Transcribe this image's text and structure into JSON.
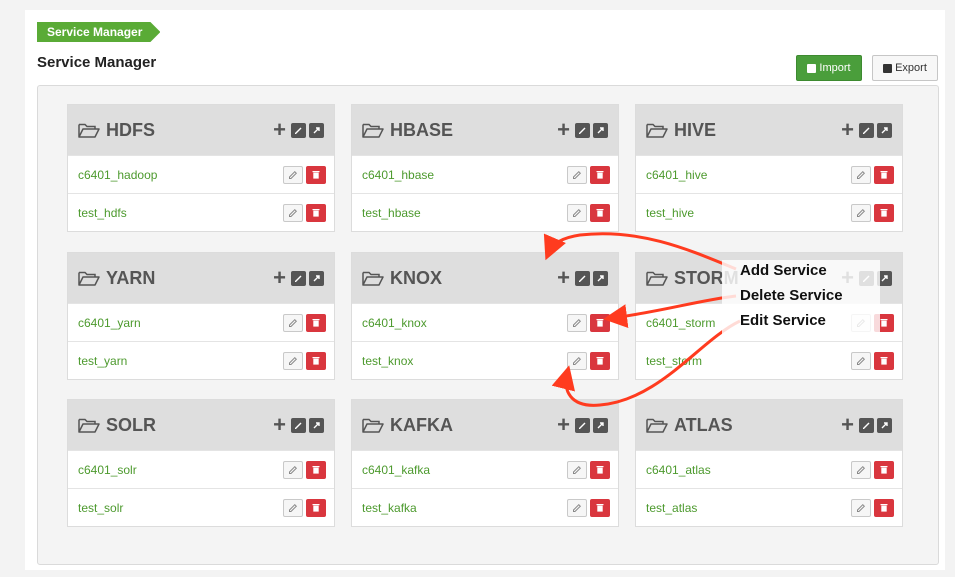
{
  "breadcrumb": "Service Manager",
  "page_title": "Service Manager",
  "toolbar": {
    "import_label": "Import",
    "export_label": "Export"
  },
  "colors": {
    "accent_green": "#5aab36",
    "delete_red": "#d9363e",
    "link_green": "#4d9a2e"
  },
  "services": [
    {
      "name": "HDFS",
      "items": [
        "c6401_hadoop",
        "test_hdfs"
      ]
    },
    {
      "name": "HBASE",
      "items": [
        "c6401_hbase",
        "test_hbase"
      ]
    },
    {
      "name": "HIVE",
      "items": [
        "c6401_hive",
        "test_hive"
      ]
    },
    {
      "name": "YARN",
      "items": [
        "c6401_yarn",
        "test_yarn"
      ]
    },
    {
      "name": "KNOX",
      "items": [
        "c6401_knox",
        "test_knox"
      ]
    },
    {
      "name": "STORM",
      "items": [
        "c6401_storm",
        "test_storm"
      ]
    },
    {
      "name": "SOLR",
      "items": [
        "c6401_solr",
        "test_solr"
      ]
    },
    {
      "name": "KAFKA",
      "items": [
        "c6401_kafka",
        "test_kafka"
      ]
    },
    {
      "name": "ATLAS",
      "items": [
        "c6401_atlas",
        "test_atlas"
      ]
    }
  ],
  "annotations": {
    "add": "Add Service",
    "delete": "Delete Service",
    "edit": "Edit Service"
  },
  "icons": {
    "folder": "folder-open-icon",
    "add": "plus-icon",
    "edit": "edit-icon",
    "export": "export-icon",
    "delete": "trash-icon"
  }
}
